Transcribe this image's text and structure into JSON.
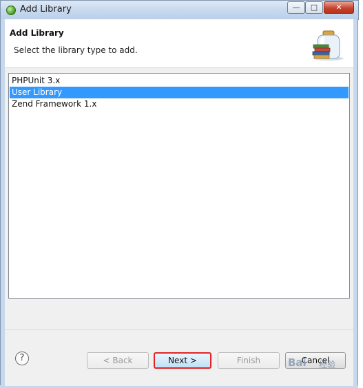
{
  "window": {
    "title": "Add Library",
    "min_glyph": "—",
    "max_glyph": "□",
    "close_glyph": "✕"
  },
  "header": {
    "title": "Add Library",
    "description": "Select the library type to add."
  },
  "list": {
    "items": [
      {
        "label": "PHPUnit 3.x",
        "selected": false
      },
      {
        "label": "User Library",
        "selected": true
      },
      {
        "label": "Zend Framework 1.x",
        "selected": false
      }
    ]
  },
  "footer": {
    "help_glyph": "?",
    "back_label": "< Back",
    "next_label": "Next >",
    "finish_label": "Finish",
    "cancel_label": "Cancel"
  },
  "watermark": {
    "logo": "Bai",
    "subtitle": "经验"
  },
  "colors": {
    "selection": "#3399ff",
    "next_highlight": "#e02424",
    "titlebar": "#c7d9ee"
  },
  "icons": {
    "app": "eclipse-icon",
    "header": "library-jar-icon",
    "help": "help-icon"
  }
}
